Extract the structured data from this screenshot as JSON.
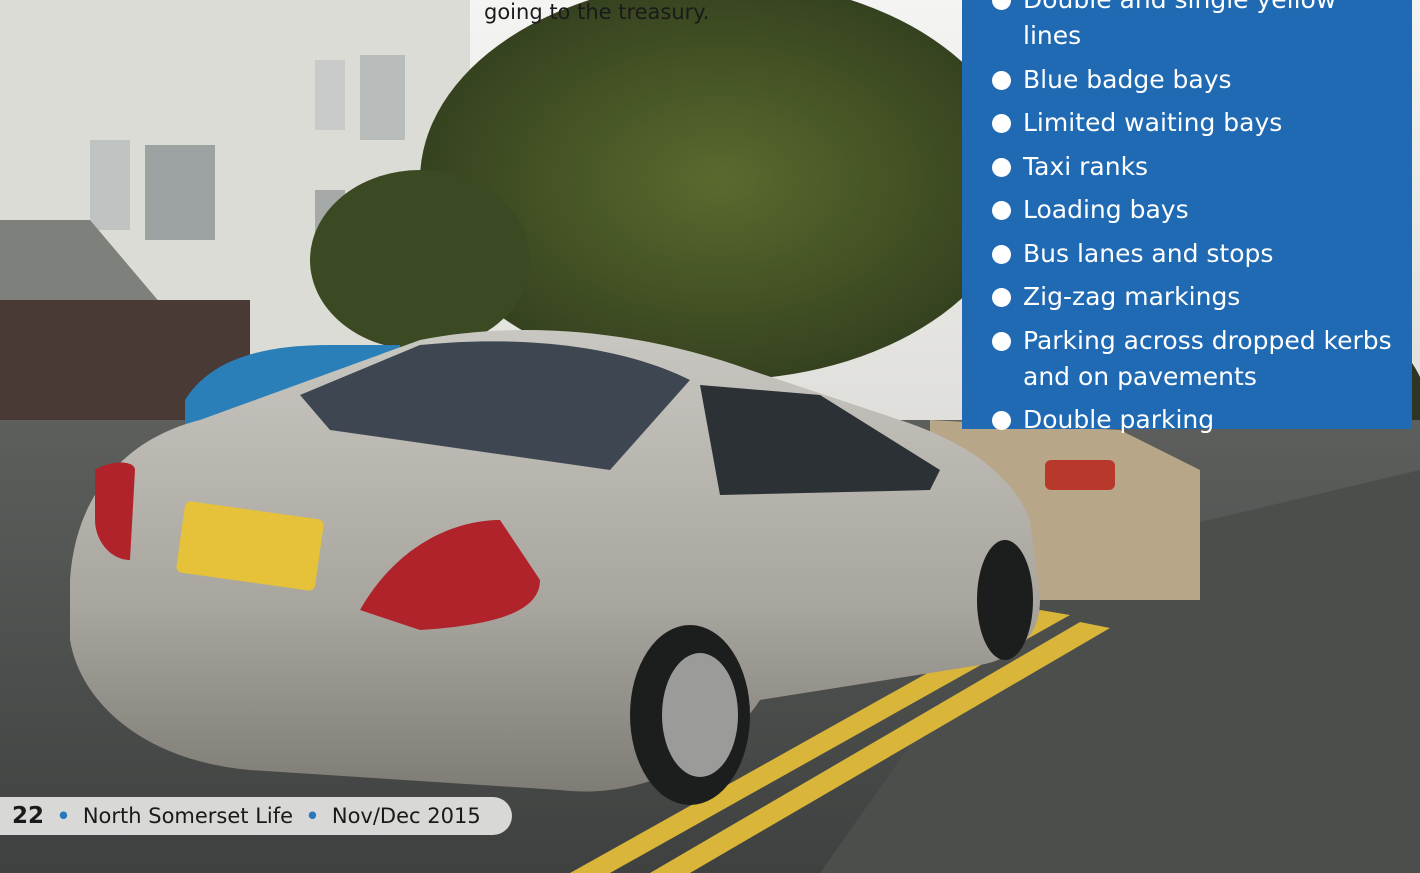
{
  "caption": {
    "text": "going to the treasury."
  },
  "info_panel": {
    "items": [
      {
        "label": "Double and single yellow lines"
      },
      {
        "label": "Blue badge bays"
      },
      {
        "label": "Limited waiting bays"
      },
      {
        "label": "Taxi ranks"
      },
      {
        "label": "Loading bays"
      },
      {
        "label": "Bus lanes and stops"
      },
      {
        "label": "Zig-zag markings"
      },
      {
        "label": "Parking across dropped kerbs and on pavements"
      },
      {
        "label": "Double parking"
      }
    ]
  },
  "footer": {
    "page_number": "22",
    "publication": "North Somerset Life",
    "issue": "Nov/Dec 2015",
    "separator": "•"
  },
  "colors": {
    "panel_blue": "#1f6ab3",
    "separator_blue": "#2a76bf",
    "yellow_line": "#d9b53a"
  }
}
